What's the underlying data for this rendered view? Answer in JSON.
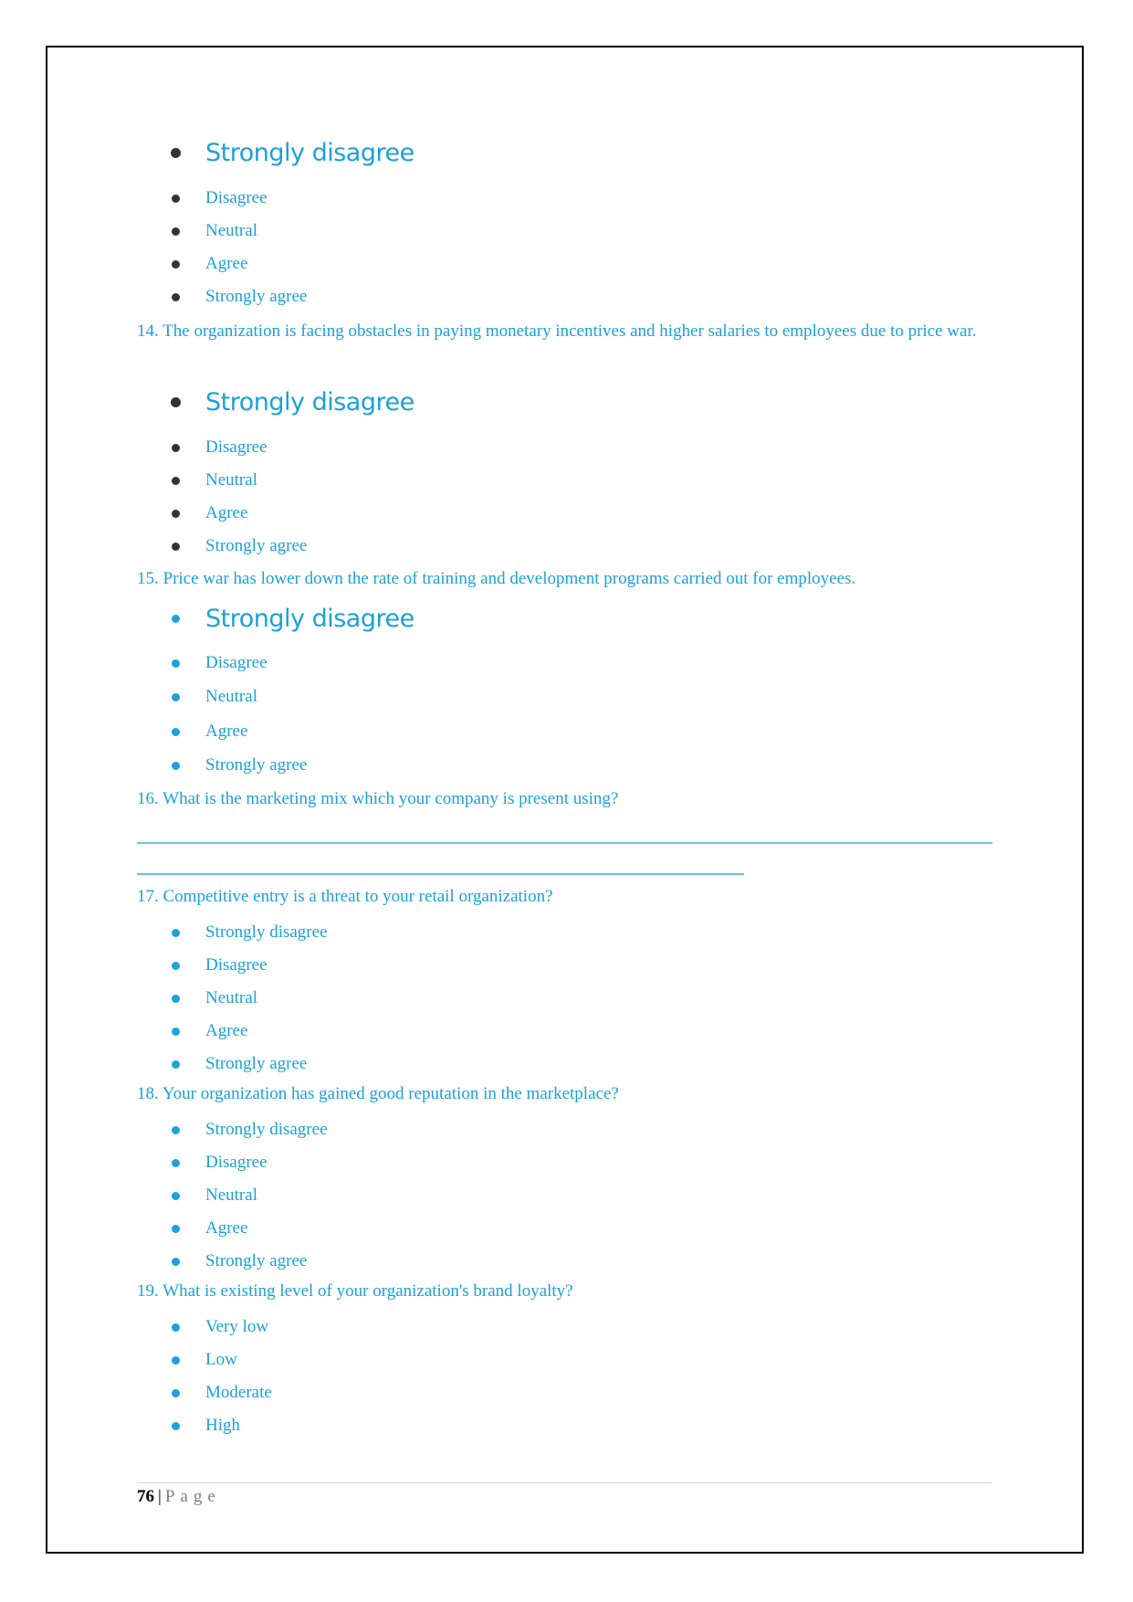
{
  "colors": {
    "text_accent": "#1ba1d8",
    "bullet_dark": "#333333",
    "bullet_blue": "#1ba1e2",
    "border": "#000000"
  },
  "question_13_options": {
    "bullet_style": "dark",
    "items": [
      "Strongly disagree",
      "Disagree",
      "Neutral",
      "Agree",
      "Strongly agree"
    ]
  },
  "question_14": {
    "text": "14. The organization is facing obstacles in paying monetary incentives and higher salaries to employees due to price war.",
    "bullet_style": "dark",
    "options": [
      "Strongly disagree",
      "Disagree",
      "Neutral",
      "Agree",
      "Strongly agree"
    ]
  },
  "question_15": {
    "text": "15. Price war has lower down the rate of training and development programs carried out for employees.",
    "bullet_style": "blue",
    "options": [
      "Strongly disagree",
      "Disagree",
      "Neutral",
      "Agree",
      "Strongly agree"
    ]
  },
  "question_16": {
    "text": "16. What is the marketing mix which your company is present using?",
    "answer": ""
  },
  "question_17": {
    "text": "17. Competitive entry is a threat to your retail organization?",
    "options": [
      "Strongly disagree",
      "Disagree",
      "Neutral",
      "Agree",
      "Strongly agree"
    ]
  },
  "question_18": {
    "text": "18. Your organization has gained good reputation in the marketplace?",
    "options": [
      "Strongly disagree",
      "Disagree",
      "Neutral",
      "Agree",
      "Strongly agree"
    ]
  },
  "question_19": {
    "text": "19. What is existing level of your organization's brand loyalty?",
    "options": [
      "Very low",
      "Low",
      "Moderate",
      "High"
    ]
  },
  "footer": {
    "page_number": "76",
    "separator": "|",
    "page_label": "Page"
  }
}
